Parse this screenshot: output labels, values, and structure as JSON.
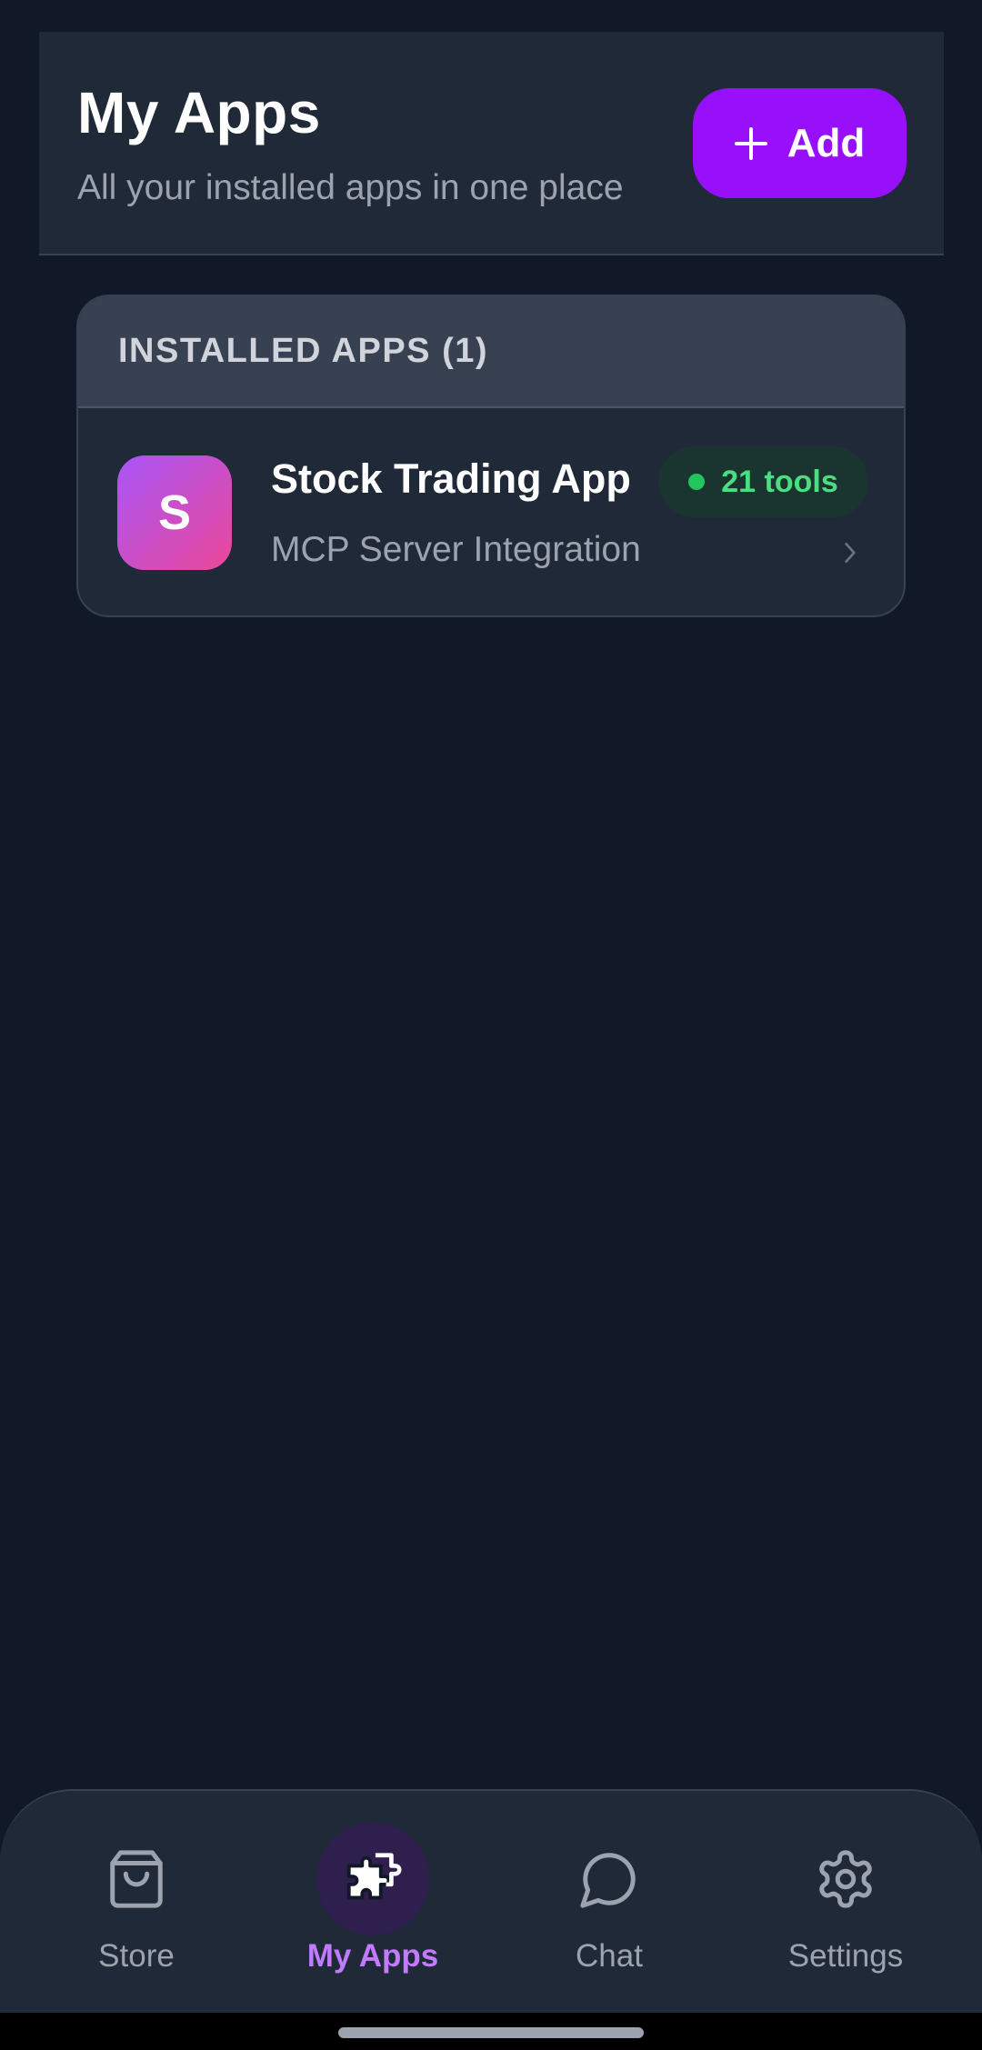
{
  "header": {
    "title": "My Apps",
    "subtitle": "All your installed apps in one place",
    "add_button": {
      "label": "Add",
      "icon": "plus-icon"
    }
  },
  "installed_apps": {
    "section_label": "INSTALLED APPS (1)",
    "items": [
      {
        "icon_letter": "S",
        "name": "Stock Trading App",
        "description": "MCP Server Integration",
        "tools_badge": "21 tools",
        "status_color": "#22c55e"
      }
    ]
  },
  "bottom_nav": {
    "items": [
      {
        "label": "Store",
        "icon": "shopping-bag-icon",
        "active": false
      },
      {
        "label": "My Apps",
        "icon": "puzzle-icon",
        "active": true
      },
      {
        "label": "Chat",
        "icon": "chat-bubble-icon",
        "active": false
      },
      {
        "label": "Settings",
        "icon": "gear-icon",
        "active": false
      }
    ]
  },
  "colors": {
    "background": "#111827",
    "surface": "#1f2937",
    "accent": "#9810fa",
    "active_nav": "#c27aff",
    "status_green": "#22c55e"
  }
}
